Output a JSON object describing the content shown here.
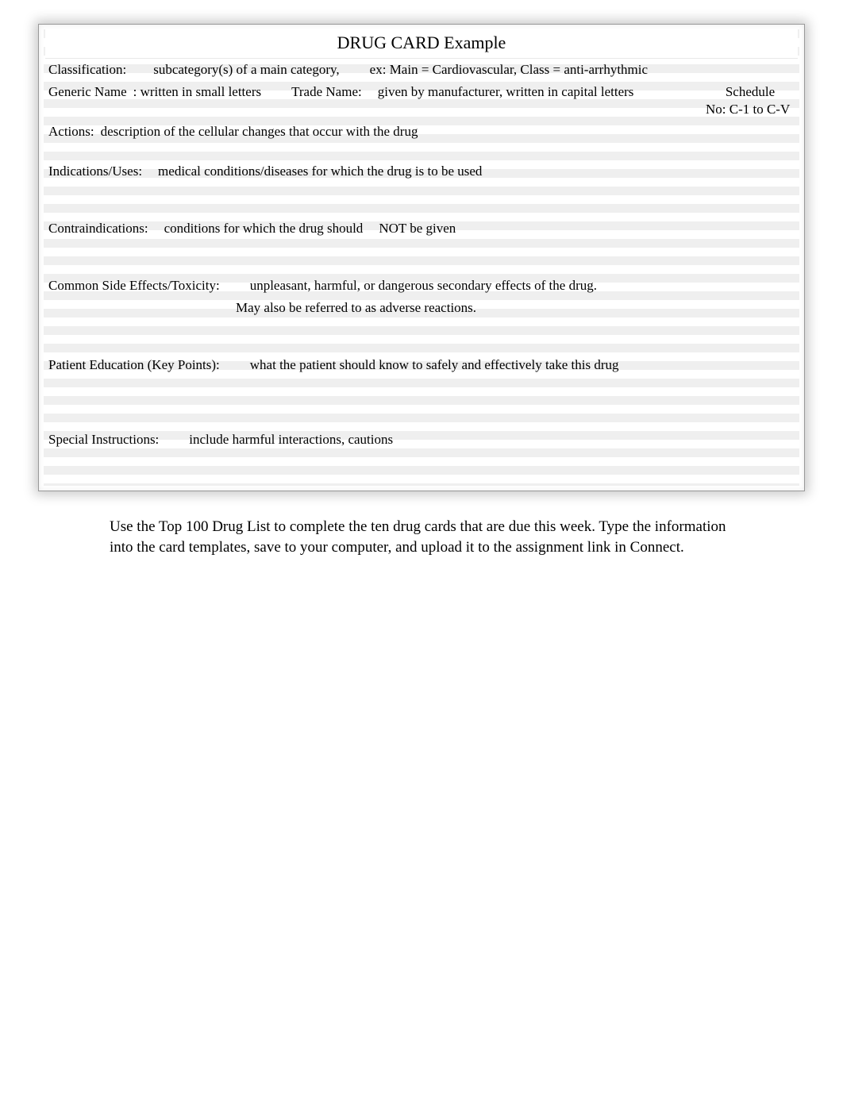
{
  "title": "DRUG CARD  Example",
  "rows": {
    "classification": {
      "label": "Classification:",
      "value": "subcategory(s) of a main category,",
      "example": "ex: Main = Cardiovascular, Class = anti-arrhythmic"
    },
    "generic": {
      "label": "Generic Name",
      "value": ": written in small letters"
    },
    "trade": {
      "label": "Trade Name:",
      "value": "given by manufacturer, written in capital letters"
    },
    "schedule": {
      "label": "Schedule",
      "value": "No:  C-1 to C-V"
    },
    "actions": {
      "label": "Actions:",
      "value": "description of the cellular changes that occur with the drug"
    },
    "indications": {
      "label": "Indications/Uses:",
      "value": "medical conditions/diseases for which the drug is to be used"
    },
    "contraindications": {
      "label": "Contraindications:",
      "value_a": "conditions for which the drug should",
      "value_b": "NOT be given"
    },
    "sideeffects": {
      "label": "Common Side Effects/Toxicity:",
      "value1": "unpleasant, harmful, or dangerous secondary effects of the drug.",
      "value2": "May also be referred to as adverse reactions."
    },
    "education": {
      "label": "Patient Education (Key Points):",
      "value": "what the patient should know to safely and effectively take this drug"
    },
    "special": {
      "label": "Special Instructions:",
      "value": "include harmful interactions, cautions"
    }
  },
  "footer": "Use the Top 100 Drug List to complete the ten drug cards that are due this week.   Type the information into the card templates, save to your computer, and upload it to the assignment link in Connect."
}
